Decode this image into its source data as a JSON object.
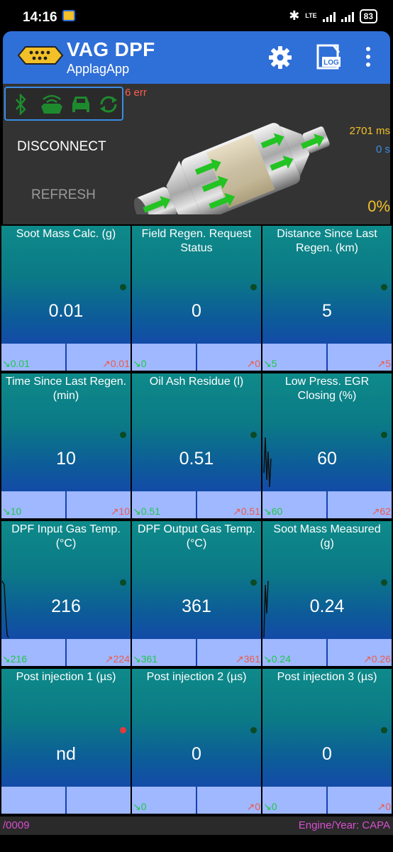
{
  "status_bar": {
    "time": "14:16",
    "network": "LTE",
    "battery": "83"
  },
  "app": {
    "title": "VAG DPF",
    "subtitle": "ApplagApp",
    "icons": [
      "engine-logo-icon",
      "gear-icon",
      "log-icon",
      "more-vert-icon"
    ],
    "log_label": "LOG"
  },
  "panel": {
    "error_count": "6 err",
    "disconnect_label": "DISCONNECT",
    "refresh_label": "REFRESH",
    "response_time": "2701 ms",
    "elapsed": "0 s",
    "percent": "0%",
    "status_icons": [
      "bluetooth-icon",
      "obd-adapter-icon",
      "car-icon",
      "sync-icon"
    ]
  },
  "colors": {
    "accent": "#2f6fd8",
    "min_value": "#1fc84a",
    "max_value": "#f05a4a",
    "footer_text": "#d84fd0",
    "response_time": "#f3c028"
  },
  "gauges": [
    {
      "title": "Soot Mass Calc. (g)",
      "value": "0.01",
      "min": "↘0.01",
      "max": "↗0.01",
      "dot": "green"
    },
    {
      "title": "Field Regen. Request Status",
      "value": "0",
      "min": "↘0",
      "max": "↗0",
      "dot": "green"
    },
    {
      "title": "Distance Since Last Regen. (km)",
      "value": "5",
      "min": "↘5",
      "max": "↗5",
      "dot": "green"
    },
    {
      "title": "Time Since Last Regen. (min)",
      "value": "10",
      "min": "↘10",
      "max": "↗10",
      "dot": "green"
    },
    {
      "title": "Oil Ash Residue (l)",
      "value": "0.51",
      "min": "↘0.51",
      "max": "↗0.51",
      "dot": "green"
    },
    {
      "title": "Low Press. EGR Closing (%)",
      "value": "60",
      "min": "↘60",
      "max": "↗62",
      "dot": "green"
    },
    {
      "title": "DPF Input Gas Temp. (°C)",
      "value": "216",
      "min": "↘216",
      "max": "↗224",
      "dot": "green"
    },
    {
      "title": "DPF Output Gas Temp. (°C)",
      "value": "361",
      "min": "↘361",
      "max": "↗361",
      "dot": "green"
    },
    {
      "title": "Soot Mass Measured (g)",
      "value": "0.24",
      "min": "↘0.24",
      "max": "↗0.26",
      "dot": "green"
    },
    {
      "title": "Post injection 1 (µs)",
      "value": "nd",
      "min": "",
      "max": "",
      "dot": "red"
    },
    {
      "title": "Post injection 2 (µs)",
      "value": "0",
      "min": "↘0",
      "max": "↗0",
      "dot": "green"
    },
    {
      "title": "Post injection 3 (µs)",
      "value": "0",
      "min": "↘0",
      "max": "↗0",
      "dot": "green"
    }
  ],
  "footer": {
    "left": "/0009",
    "right": "Engine/Year: CAPA"
  }
}
